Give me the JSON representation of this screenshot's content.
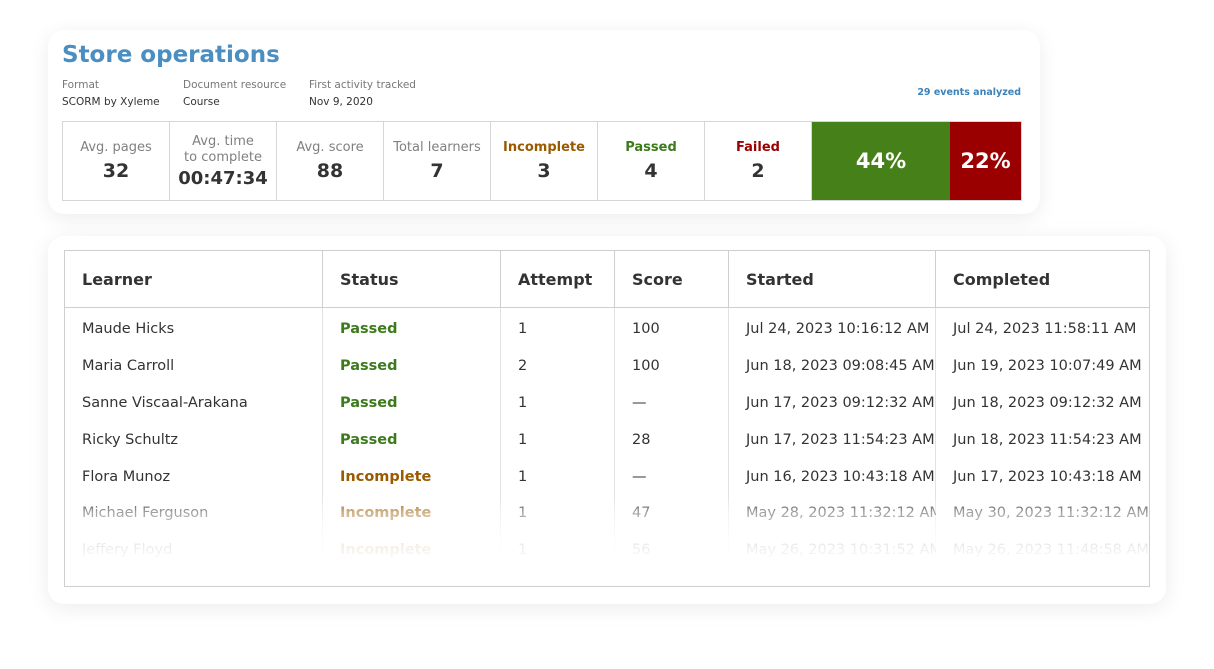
{
  "course": {
    "title": "Store operations",
    "meta": [
      {
        "label": "Format",
        "value": "SCORM by Xyleme"
      },
      {
        "label": "Document resource",
        "value": "Course"
      },
      {
        "label": "First activity tracked",
        "value": "Nov 9, 2020"
      }
    ],
    "events_analyzed": "29 events analyzed"
  },
  "stats": {
    "avg_pages": {
      "label": "Avg. pages",
      "value": "32"
    },
    "avg_time": {
      "label_line1": "Avg. time",
      "label_line2": "to complete",
      "value": "00:47:34"
    },
    "avg_score": {
      "label": "Avg. score",
      "value": "88"
    },
    "total_learners": {
      "label": "Total learners",
      "value": "7"
    },
    "incomplete": {
      "label": "Incomplete",
      "value": "3"
    },
    "passed": {
      "label": "Passed",
      "value": "4"
    },
    "failed": {
      "label": "Failed",
      "value": "2"
    },
    "pass_rate": "44%",
    "fail_rate": "22%"
  },
  "colors": {
    "title": "#4a8ec2",
    "passed": "#3c7a1c",
    "incomplete": "#9a5a00",
    "failed": "#9b0000",
    "pass_bar": "#458019",
    "fail_bar": "#9b0000"
  },
  "table": {
    "headers": [
      "Learner",
      "Status",
      "Attempt",
      "Score",
      "Started",
      "Completed"
    ],
    "rows": [
      {
        "learner": "Maude Hicks",
        "status": "Passed",
        "attempt": "1",
        "score": "100",
        "started": "Jul 24, 2023  10:16:12 AM",
        "completed": "Jul 24, 2023  11:58:11 AM"
      },
      {
        "learner": "Maria Carroll",
        "status": "Passed",
        "attempt": "2",
        "score": "100",
        "started": "Jun 18, 2023 09:08:45 AM",
        "completed": "Jun 19, 2023 10:07:49 AM"
      },
      {
        "learner": "Sanne Viscaal-Arakana",
        "status": "Passed",
        "attempt": "1",
        "score": "—",
        "started": "Jun 17, 2023 09:12:32 AM",
        "completed": "Jun 18, 2023 09:12:32 AM"
      },
      {
        "learner": "Ricky Schultz",
        "status": "Passed",
        "attempt": "1",
        "score": "28",
        "started": "Jun 17, 2023 11:54:23 AM",
        "completed": "Jun 18, 2023 11:54:23 AM"
      },
      {
        "learner": "Flora Munoz",
        "status": "Incomplete",
        "attempt": "1",
        "score": "—",
        "started": "Jun 16, 2023 10:43:18 AM",
        "completed": "Jun 17, 2023 10:43:18 AM"
      },
      {
        "learner": "Michael Ferguson",
        "status": "Incomplete",
        "attempt": "1",
        "score": "47",
        "started": "May 28, 2023 11:32:12 AM",
        "completed": "May 30, 2023 11:32:12 AM"
      },
      {
        "learner": "Jeffery Floyd",
        "status": "Incomplete",
        "attempt": "1",
        "score": "56",
        "started": "May 26, 2023 10:31:52 AM",
        "completed": "May 26, 2023 11:48:58 AM"
      }
    ]
  }
}
